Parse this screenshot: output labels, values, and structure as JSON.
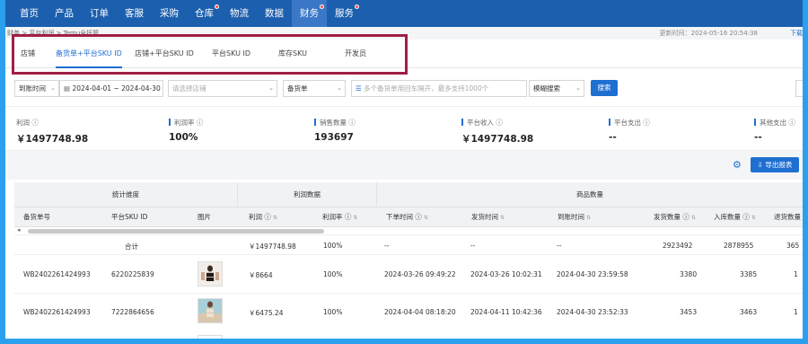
{
  "nav": {
    "items": [
      {
        "label": "首页",
        "dot": false,
        "active": false
      },
      {
        "label": "产品",
        "dot": false,
        "active": false
      },
      {
        "label": "订单",
        "dot": false,
        "active": false
      },
      {
        "label": "客服",
        "dot": false,
        "active": false
      },
      {
        "label": "采购",
        "dot": false,
        "active": false
      },
      {
        "label": "仓库",
        "dot": true,
        "active": false
      },
      {
        "label": "物流",
        "dot": false,
        "active": false
      },
      {
        "label": "数据",
        "dot": false,
        "active": false
      },
      {
        "label": "财务",
        "dot": true,
        "active": true
      },
      {
        "label": "服务",
        "dot": true,
        "active": false
      }
    ]
  },
  "breadcrumb": {
    "path": "财务 > 平台利润 >",
    "current": "Temu全托管"
  },
  "update_time": "更新时间：2024-05-16 20:54:38",
  "download_label": "下载",
  "tabs": [
    "店铺",
    "备货单+平台SKU ID",
    "店铺+平台SKU ID",
    "平台SKU ID",
    "库存SKU",
    "开发员"
  ],
  "active_tab": "备货单+平台SKU ID",
  "filters": {
    "date_type": "到账时间",
    "date_range": "2024-04-01 ~ 2024-04-30",
    "shop_placeholder": "请选择店铺",
    "order_type": "备货单",
    "search_placeholder": "多个备货单用回车隔开，最多支持1000个",
    "match_mode": "模糊搜索",
    "search_button": "搜索"
  },
  "stats": [
    {
      "label": "利润",
      "value": "￥1497748.98"
    },
    {
      "label": "利润率",
      "value": "100%"
    },
    {
      "label": "销售数量",
      "value": "193697"
    },
    {
      "label": "平台收入",
      "value": "￥1497748.98"
    },
    {
      "label": "平台支出",
      "value": "--"
    },
    {
      "label": "其他支出",
      "value": "--"
    }
  ],
  "export_label": "导出报表",
  "table": {
    "groups": [
      "统计维度",
      "利润数据",
      "商品数量"
    ],
    "headers": [
      "备货单号",
      "平台SKU ID",
      "图片",
      "利润",
      "利润率",
      "下单时间",
      "发货时间",
      "到账时间",
      "发货数量",
      "入库数量",
      "退货数量"
    ],
    "total": {
      "label": "合计",
      "profit": "￥1497748.98",
      "rate": "100%",
      "order_time": "--",
      "ship_time": "--",
      "arrive_time": "--",
      "ship_qty": "2923492",
      "in_qty": "2878955",
      "return_qty": "365"
    },
    "rows": [
      {
        "order_no": "WB2402261424993",
        "sku": "6220225839",
        "profit": "￥8664",
        "rate": "100%",
        "order_time": "2024-03-26 09:49:22",
        "ship_time": "2024-03-26 10:02:31",
        "arrive_time": "2024-04-30 23:59:58",
        "ship_qty": "3380",
        "in_qty": "3385",
        "return_qty": "1"
      },
      {
        "order_no": "WB2402261424993",
        "sku": "7222864656",
        "profit": "￥6475.24",
        "rate": "100%",
        "order_time": "2024-04-04 08:18:20",
        "ship_time": "2024-04-11 10:42:36",
        "arrive_time": "2024-04-30 23:52:33",
        "ship_qty": "3453",
        "in_qty": "3463",
        "return_qty": "1"
      }
    ]
  },
  "colors": {
    "nav_bg": "#1c5fae",
    "accent": "#1f6fd1",
    "highlight_border": "#a11e45",
    "frame_border": "#2aa0ee"
  }
}
